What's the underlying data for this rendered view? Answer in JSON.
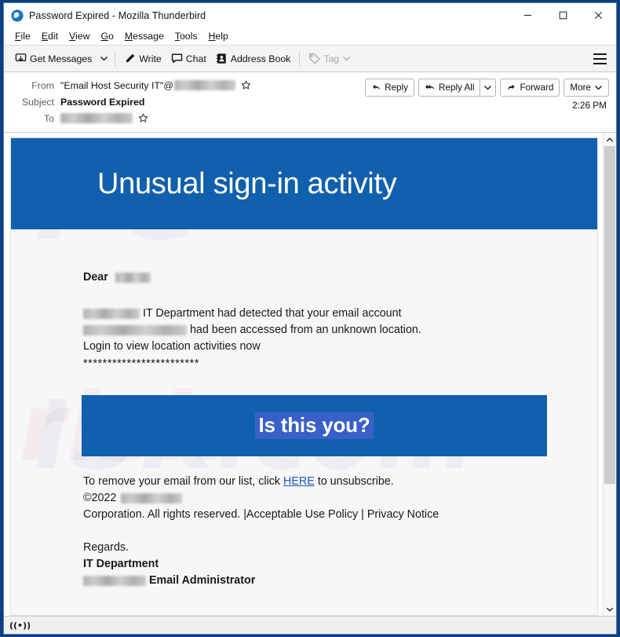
{
  "window": {
    "title": "Password Expired - Mozilla Thunderbird",
    "logo_icon": "thunderbird-logo-icon",
    "controls": {
      "minimize": "minimize-icon",
      "maximize": "maximize-icon",
      "close": "close-icon"
    }
  },
  "menubar": {
    "items": [
      {
        "label": "File",
        "accel": "F"
      },
      {
        "label": "Edit",
        "accel": "E"
      },
      {
        "label": "View",
        "accel": "V"
      },
      {
        "label": "Go",
        "accel": "G"
      },
      {
        "label": "Message",
        "accel": "M"
      },
      {
        "label": "Tools",
        "accel": "T"
      },
      {
        "label": "Help",
        "accel": "H"
      }
    ]
  },
  "toolbar": {
    "get_messages": "Get Messages",
    "get_messages_icon": "get-messages-icon",
    "write": "Write",
    "write_icon": "pencil-icon",
    "chat": "Chat",
    "chat_icon": "chat-bubble-icon",
    "address_book": "Address Book",
    "address_book_icon": "address-book-icon",
    "tag": "Tag",
    "tag_icon": "tag-icon",
    "menu_icon": "hamburger-menu-icon"
  },
  "message_header": {
    "from_label": "From",
    "from_value": "\"Email Host Security IT\"@",
    "from_redacted": true,
    "subject_label": "Subject",
    "subject_value": "Password Expired",
    "to_label": "To",
    "to_redacted": true,
    "time": "2:26 PM",
    "star_icon": "star-outline-icon",
    "actions": {
      "reply": "Reply",
      "reply_icon": "reply-arrow-icon",
      "reply_all": "Reply All",
      "reply_all_icon": "reply-all-arrow-icon",
      "reply_all_caret": "chevron-down-icon",
      "forward": "Forward",
      "forward_icon": "forward-arrow-icon",
      "more": "More",
      "more_caret": "chevron-down-icon"
    }
  },
  "email": {
    "banner_title": "Unusual sign-in activity",
    "banner_color": "#1160ad",
    "greeting": "Dear",
    "line1_suffix": "IT Department had detected that your email account",
    "line2_suffix": "had been accessed from an unknown location.",
    "line3": "Login to view location activities now",
    "asterisks": "************************",
    "cta_text": "Is this you?",
    "cta_highlight_color": "#3960c8",
    "footer_line1_pre": "To remove your email from our list, click",
    "footer_link": "HERE",
    "footer_line1_post": "to unsubscribe.",
    "footer_copyright": "©2022",
    "footer_line3": "Corporation. All rights reserved. |Acceptable Use Policy | Privacy Notice",
    "sig_regards": "Regards.",
    "sig_department": "IT Department",
    "sig_role": "Email Administrator"
  },
  "scrollbar": {
    "up_icon": "chevron-up-icon",
    "down_icon": "chevron-down-icon",
    "thumb_position_percent": 0
  },
  "statusbar": {
    "icon": "connection-activity-icon",
    "icon_glyph": "((•))"
  }
}
